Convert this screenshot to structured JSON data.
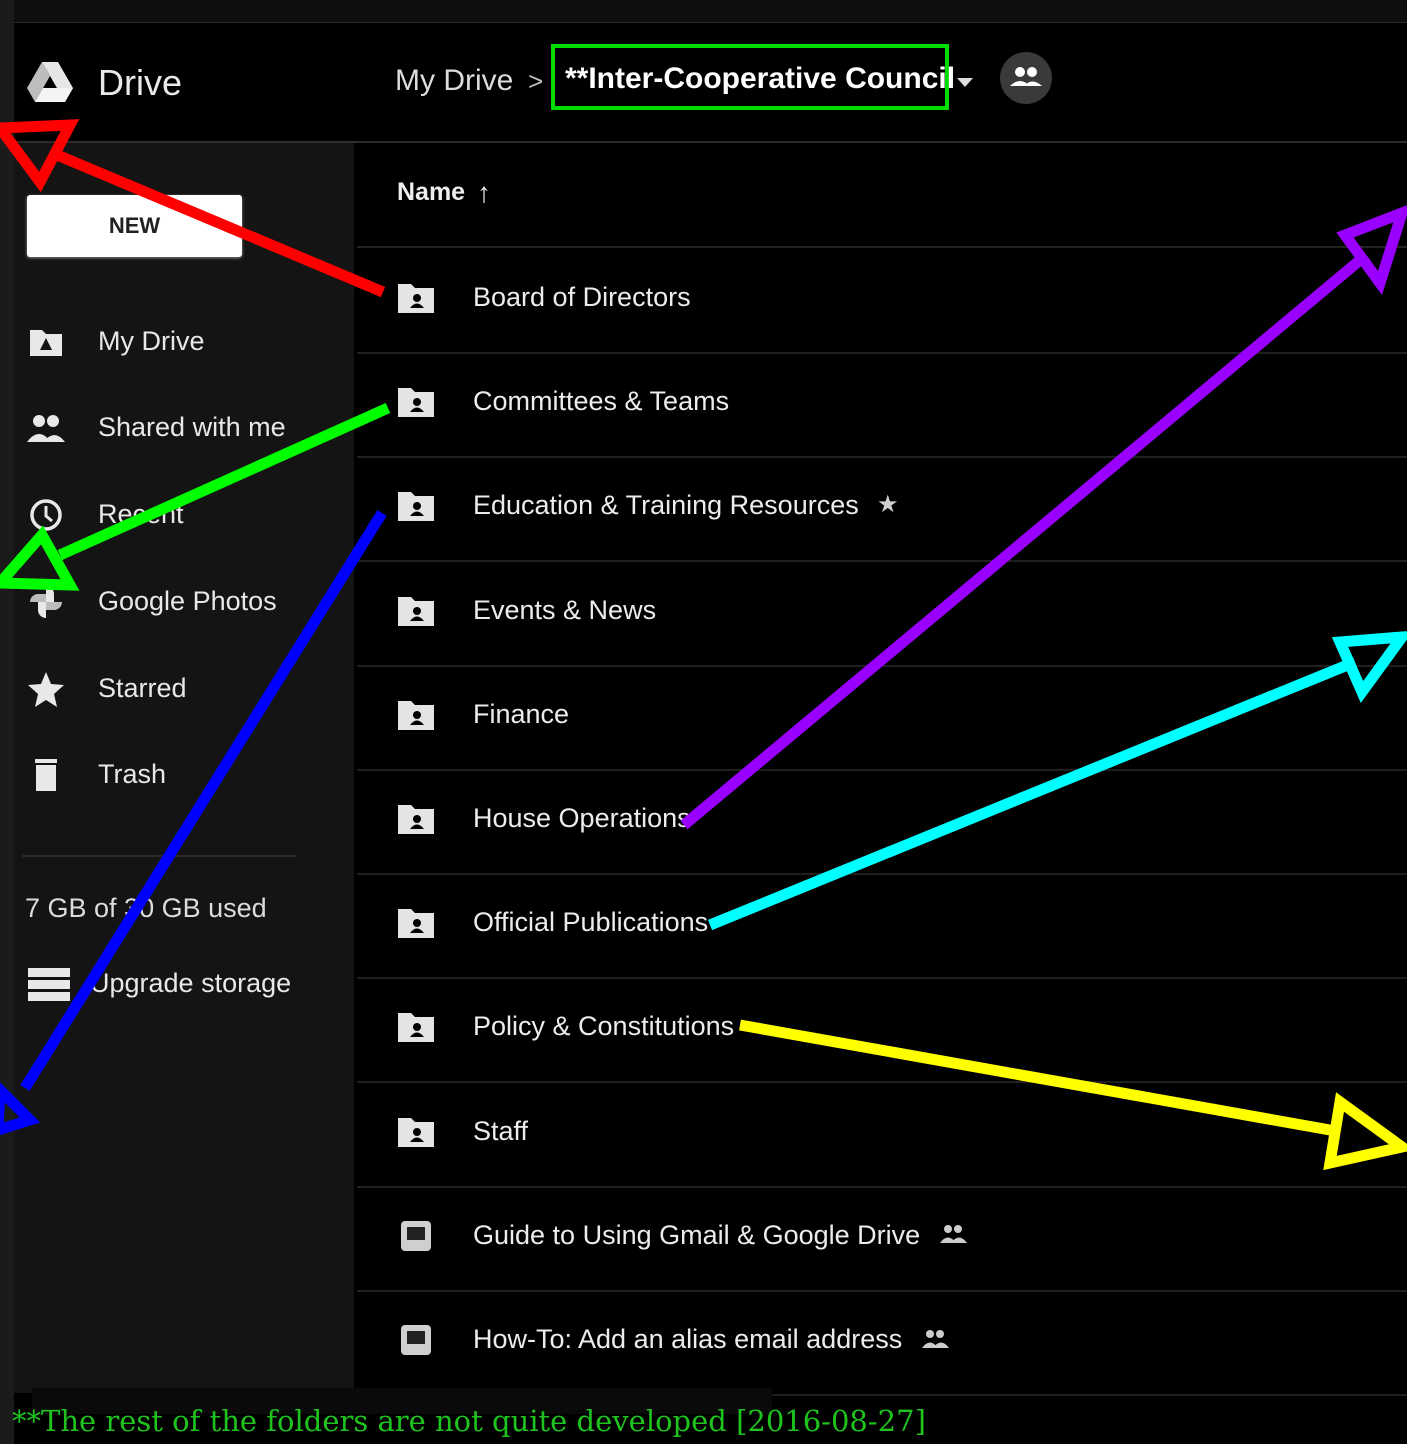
{
  "app": {
    "name": "Drive"
  },
  "breadcrumb": {
    "root": "My Drive",
    "separator": ">",
    "current": "**Inter-Cooperative Council"
  },
  "sidebar": {
    "new_button": "NEW",
    "items": [
      {
        "label": "My Drive",
        "icon": "my-drive-icon"
      },
      {
        "label": "Shared with me",
        "icon": "shared-icon"
      },
      {
        "label": "Recent",
        "icon": "clock-icon"
      },
      {
        "label": "Google Photos",
        "icon": "photos-icon"
      },
      {
        "label": "Starred",
        "icon": "star-icon"
      },
      {
        "label": "Trash",
        "icon": "trash-icon"
      }
    ],
    "storage": "7 GB of 30 GB used",
    "upgrade": "Upgrade storage"
  },
  "list": {
    "sort_column": "Name",
    "sort_arrow": "↑",
    "rows": [
      {
        "name": "Board of Directors",
        "type": "shared-folder"
      },
      {
        "name": "Committees & Teams",
        "type": "shared-folder"
      },
      {
        "name": "Education & Training Resources",
        "type": "shared-folder",
        "badge": "★"
      },
      {
        "name": "Events & News",
        "type": "shared-folder"
      },
      {
        "name": "Finance",
        "type": "shared-folder"
      },
      {
        "name": "House Operations",
        "type": "shared-folder"
      },
      {
        "name": "Official Publications",
        "type": "shared-folder"
      },
      {
        "name": "Policy & Constitutions",
        "type": "shared-folder"
      },
      {
        "name": "Staff",
        "type": "shared-folder"
      },
      {
        "name": "Guide to Using Gmail & Google Drive",
        "type": "slides",
        "badge": "shared"
      },
      {
        "name": "How-To: Add an alias email address",
        "type": "slides",
        "badge": "shared"
      }
    ]
  },
  "footnote": "**The rest of the folders are not quite developed [2016-08-27]",
  "colors": {
    "highlight_box": "#00dd00",
    "arrow_red": "#ff0000",
    "arrow_green": "#00ff00",
    "arrow_blue": "#0000ff",
    "arrow_purple": "#9900ff",
    "arrow_cyan": "#00ffff",
    "arrow_yellow": "#ffff00",
    "footnote_text": "#1ec31e"
  }
}
